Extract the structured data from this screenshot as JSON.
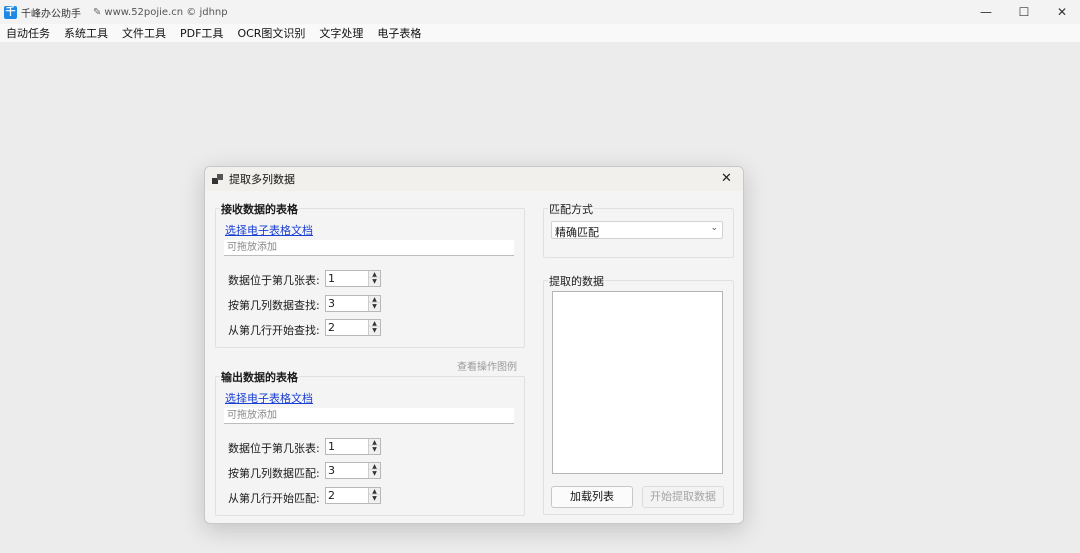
{
  "window": {
    "title": "千峰办公助手",
    "subtitle": "www.52pojie.cn © jdhnp",
    "minimize_icon": "—",
    "maximize_icon": "☐",
    "close_icon": "✕"
  },
  "menu": [
    "自动任务",
    "系统工具",
    "文件工具",
    "PDF工具",
    "OCR图文识别",
    "文字处理",
    "电子表格"
  ],
  "dialog": {
    "title": "提取多列数据",
    "close_icon": "✕",
    "receive": {
      "group_title": "接收数据的表格",
      "select_link": "选择电子表格文档",
      "drop_placeholder": "可拖放添加",
      "rows": [
        {
          "label": "数据位于第几张表:",
          "value": "1"
        },
        {
          "label": "按第几列数据查找:",
          "value": "3"
        },
        {
          "label": "从第几行开始查找:",
          "value": "2"
        }
      ]
    },
    "view_example": "查看操作图例",
    "output": {
      "group_title": "输出数据的表格",
      "select_link": "选择电子表格文档",
      "drop_placeholder": "可拖放添加",
      "rows": [
        {
          "label": "数据位于第几张表:",
          "value": "1"
        },
        {
          "label": "按第几列数据匹配:",
          "value": "3"
        },
        {
          "label": "从第几行开始匹配:",
          "value": "2"
        }
      ]
    },
    "match": {
      "group_title": "匹配方式",
      "selected": "精确匹配",
      "chevron": "⌄"
    },
    "extracted": {
      "group_title": "提取的数据"
    },
    "buttons": {
      "load_list": "加载列表",
      "start_extract": "开始提取数据"
    },
    "spin_up": "▲",
    "spin_down": "▼"
  }
}
